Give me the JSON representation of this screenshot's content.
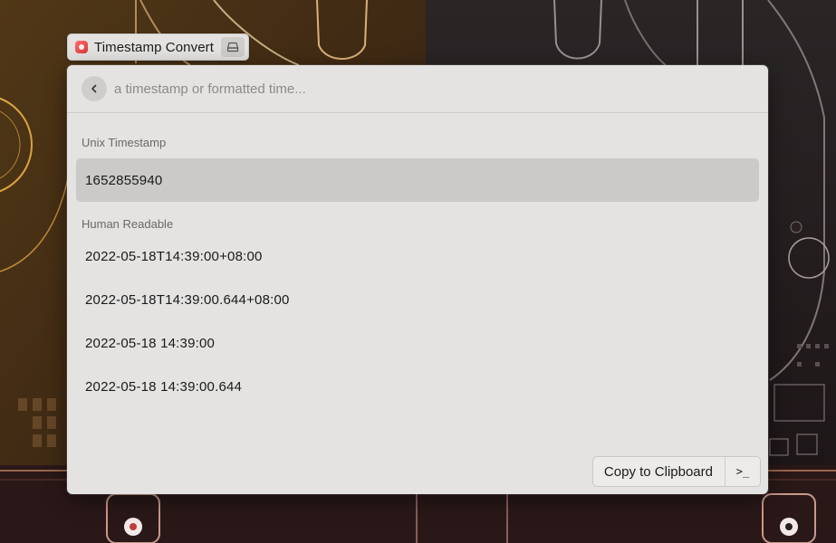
{
  "command_tag": {
    "label": "Timestamp Convert",
    "icon": "app-icon",
    "side_icon": "keyboard-icon"
  },
  "search": {
    "placeholder": "a timestamp or formatted time..."
  },
  "sections": [
    {
      "title": "Unix Timestamp",
      "items": [
        "1652855940"
      ]
    },
    {
      "title": "Human Readable",
      "items": [
        "2022-05-18T14:39:00+08:00",
        "2022-05-18T14:39:00.644+08:00",
        "2022-05-18 14:39:00",
        "2022-05-18 14:39:00.644"
      ]
    }
  ],
  "actions": {
    "primary_label": "Copy to Clipboard",
    "secondary_glyph": ">_"
  },
  "colors": {
    "panel_bg": "#e4e3e2",
    "selected_bg": "#cbcac8",
    "app_icon": "#e04646"
  }
}
